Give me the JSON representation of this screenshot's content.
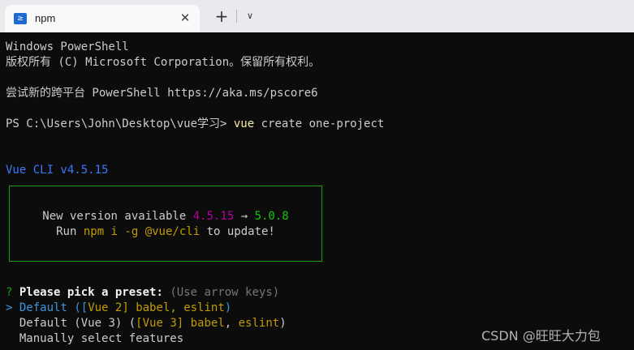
{
  "tab": {
    "icon_glyph": "≥",
    "title": "npm",
    "close_glyph": "✕",
    "new_tab_glyph": "+",
    "dropdown_glyph": "∨"
  },
  "colors": {
    "tabbar_bg": "#e8eaed",
    "terminal_bg": "#0c0c0c",
    "text": "#cccccc",
    "vue_cli_blue": "#3b78ff",
    "banner_border": "#13a10e",
    "command_yellow": "#f9f1a5"
  },
  "terminal": {
    "header_line1": "Windows PowerShell",
    "header_line2": "版权所有 (C) Microsoft Corporation。保留所有权利。",
    "tip_line": "尝试新的跨平台 PowerShell https://aka.ms/pscore6",
    "prompt": "PS C:\\Users\\John\\Desktop\\vue学习> ",
    "command_name": "vue",
    "command_args": " create one-project",
    "cli_version": "Vue CLI v4.5.15",
    "update_banner": {
      "new_version_text": "New version available ",
      "current_version": "4.5.15",
      "arrow": " → ",
      "latest_version": "5.0.8",
      "run_text": "Run ",
      "install_command": "npm i -g @vue/cli",
      "update_text": " to update!"
    },
    "preset_prompt": {
      "qmark": "?",
      "question": "Please pick a preset:",
      "hint": "(Use arrow keys)"
    },
    "options": [
      {
        "pointer": ">",
        "label": "Default",
        "detail_open": " ([",
        "detail_preset": "Vue 2",
        "detail_sep": "] babel, eslint",
        "detail_close": ")"
      },
      {
        "pointer": " ",
        "label": "Default (Vue 3)",
        "detail_open": " (",
        "detail_preset": "[Vue 3] babel",
        "detail_sep": ", ",
        "detail_tail": "eslint",
        "detail_close": ")"
      },
      {
        "pointer": " ",
        "label": "Manually select features"
      }
    ]
  },
  "watermark": "CSDN @旺旺大力包"
}
